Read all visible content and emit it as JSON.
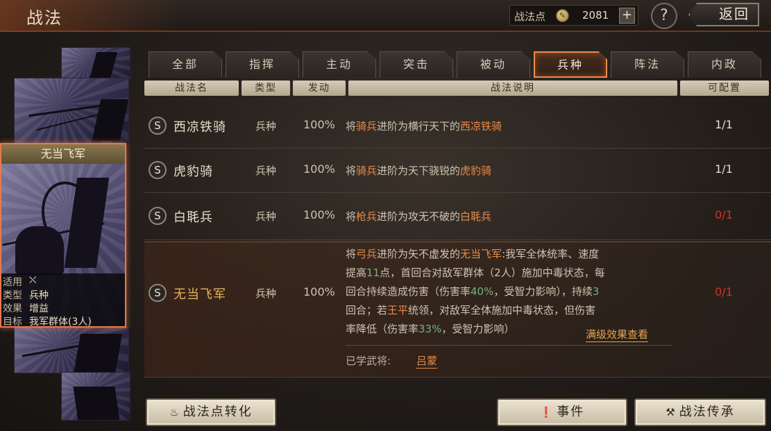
{
  "header": {
    "title": "战法",
    "points_label": "战法点",
    "points_value": "2081",
    "plus_label": "+",
    "help_label": "?",
    "back_label": "返回"
  },
  "tabs": [
    {
      "label": "全部"
    },
    {
      "label": "指挥"
    },
    {
      "label": "主动"
    },
    {
      "label": "突击"
    },
    {
      "label": "被动"
    },
    {
      "label": "兵种"
    },
    {
      "label": "阵法"
    },
    {
      "label": "内政"
    }
  ],
  "columns": [
    "战法名",
    "类型",
    "发动",
    "战法说明",
    "可配置"
  ],
  "selected_card": {
    "title": "无当飞军",
    "info": [
      {
        "key": "适用",
        "value": "⛌"
      },
      {
        "key": "类型",
        "value": "兵种"
      },
      {
        "key": "效果",
        "value": "增益"
      },
      {
        "key": "目标",
        "value": "我军群体(3人)"
      }
    ]
  },
  "rows": [
    {
      "badge": "S",
      "name": "西凉铁骑",
      "type": "兵种",
      "rate": "100%",
      "config": "1/1",
      "desc": [
        {
          "t": "将",
          "c": ""
        },
        {
          "t": "骑兵",
          "c": "hl-orange"
        },
        {
          "t": "进阶为横行天下的",
          "c": ""
        },
        {
          "t": "西凉铁骑",
          "c": "hl-orange"
        }
      ]
    },
    {
      "badge": "S",
      "name": "虎豹骑",
      "type": "兵种",
      "rate": "100%",
      "config": "1/1",
      "desc": [
        {
          "t": "将",
          "c": ""
        },
        {
          "t": "骑兵",
          "c": "hl-orange"
        },
        {
          "t": "进阶为天下骁锐的",
          "c": ""
        },
        {
          "t": "虎豹骑",
          "c": "hl-orange"
        }
      ]
    },
    {
      "badge": "S",
      "name": "白毦兵",
      "type": "兵种",
      "rate": "100%",
      "config": "0/1",
      "desc": [
        {
          "t": "将",
          "c": ""
        },
        {
          "t": "枪兵",
          "c": "hl-orange"
        },
        {
          "t": "进阶为攻无不破的",
          "c": ""
        },
        {
          "t": "白毦兵",
          "c": "hl-orange"
        }
      ]
    },
    {
      "badge": "S",
      "name": "无当飞军",
      "type": "兵种",
      "rate": "100%",
      "config": "0/1",
      "long_desc": [
        [
          {
            "t": "将",
            "c": ""
          },
          {
            "t": "弓兵",
            "c": "hl-orange"
          },
          {
            "t": "进阶为矢不虚发的",
            "c": ""
          },
          {
            "t": "无当飞军",
            "c": "hl-orange"
          },
          {
            "t": ":我军全体统率、速度",
            "c": ""
          }
        ],
        [
          {
            "t": "提高",
            "c": ""
          },
          {
            "t": "11",
            "c": "hl-green"
          },
          {
            "t": "点，首回合对敌军群体（2人）施加中毒状态，每",
            "c": ""
          }
        ],
        [
          {
            "t": "回合持续造成伤害（伤害率",
            "c": ""
          },
          {
            "t": "40%",
            "c": "hl-green"
          },
          {
            "t": "，受智力影响），持续",
            "c": ""
          },
          {
            "t": "3",
            "c": "hl-green"
          }
        ],
        [
          {
            "t": "回合；若",
            "c": ""
          },
          {
            "t": "王平",
            "c": "hl-orange"
          },
          {
            "t": "统领，对敌军全体施加中毒状态，但伤害",
            "c": ""
          }
        ],
        [
          {
            "t": "率降低（伤害率",
            "c": ""
          },
          {
            "t": "33%",
            "c": "hl-green"
          },
          {
            "t": "，受智力影响）",
            "c": ""
          }
        ]
      ],
      "full_effect_link": "满级效果查看",
      "learned_label": "已学武将:",
      "learned_name": "吕蒙"
    }
  ],
  "buttons": {
    "convert": "战法点转化",
    "events": "事件",
    "inherit": "战法传承"
  },
  "colors": {
    "accent": "#f08b4a",
    "highlight_orange": "#ea8a4a",
    "highlight_green": "#76b27a",
    "config_red": "#d2322a"
  }
}
